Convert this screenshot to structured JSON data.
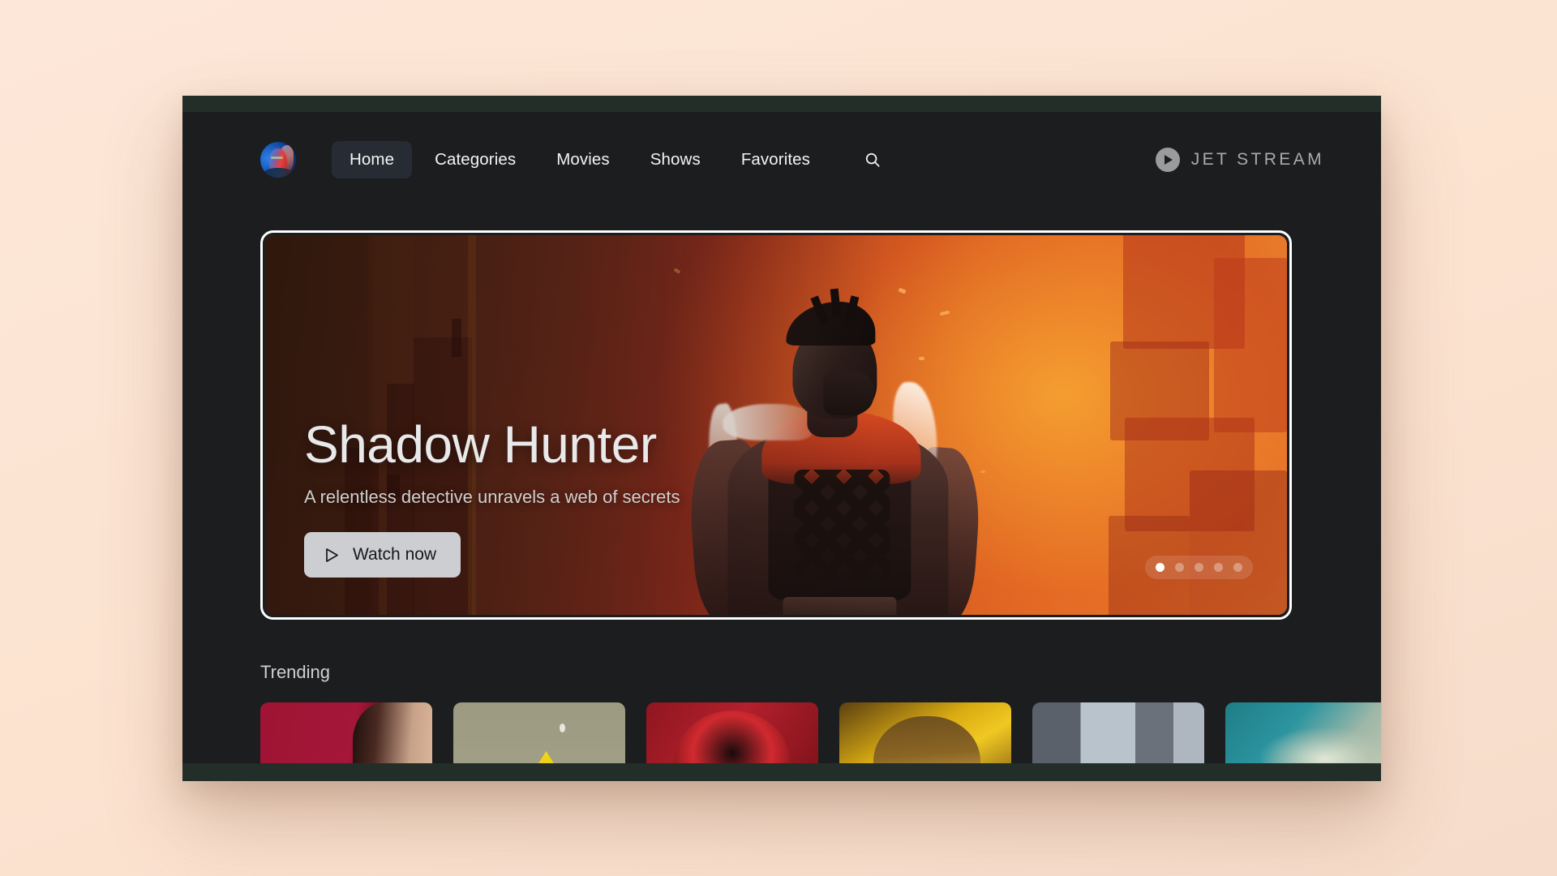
{
  "app": {
    "brand_name": "JET STREAM",
    "brand_icon": "play-circle-icon",
    "frame_color": "#232e29",
    "surface_color": "#1b1d1f",
    "page_background": "#fce4d3"
  },
  "nav": {
    "avatar_icon": "user-avatar",
    "search_icon": "search-icon",
    "items": [
      {
        "label": "Home",
        "active": true
      },
      {
        "label": "Categories",
        "active": false
      },
      {
        "label": "Movies",
        "active": false
      },
      {
        "label": "Shows",
        "active": false
      },
      {
        "label": "Favorites",
        "active": false
      }
    ],
    "active_pill_color": "#272c34"
  },
  "hero": {
    "title": "Shadow Hunter",
    "subtitle": "A relentless detective unravels a web of secrets",
    "cta_label": "Watch now",
    "cta_icon": "play-triangle-icon",
    "focus_ring_color": "#ffffff",
    "carousel": {
      "total": 5,
      "active_index": 1,
      "dot_active_color": "#ffffff",
      "dot_inactive_color": "rgba(255,255,255,0.33)"
    }
  },
  "sections": [
    {
      "title": "Trending",
      "cards": [
        {
          "name": "trending-card-1"
        },
        {
          "name": "trending-card-2"
        },
        {
          "name": "trending-card-3"
        },
        {
          "name": "trending-card-4"
        },
        {
          "name": "trending-card-5"
        },
        {
          "name": "trending-card-6"
        }
      ]
    }
  ]
}
